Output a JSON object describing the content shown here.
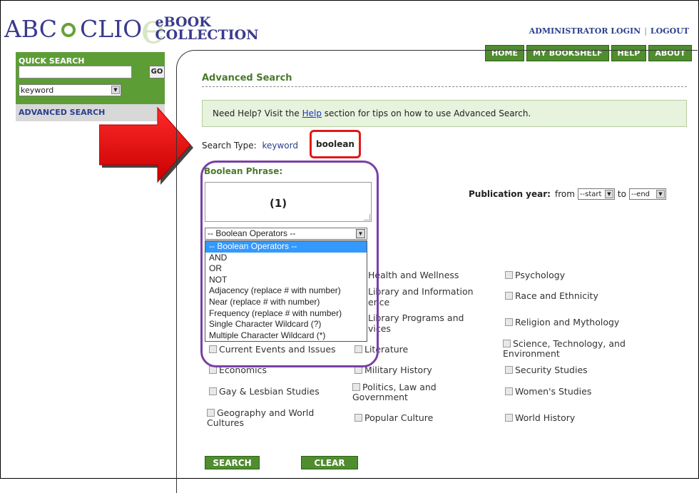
{
  "header": {
    "logo_left": "ABC",
    "logo_right": "CLIO",
    "logo_e": "e",
    "logo_ebook": "eBOOK",
    "logo_collection": "COLLECTION",
    "admin_login": "ADMINISTRATOR LOGIN",
    "separator": "|",
    "logout": "LOGOUT"
  },
  "nav": {
    "home": "HOME",
    "bookshelf": "MY BOOKSHELF",
    "help": "HELP",
    "about": "ABOUT"
  },
  "sidebar": {
    "quick_search_title": "QUICK SEARCH",
    "go_label": "GO",
    "search_type_value": "keyword",
    "advanced_search": "ADVANCED SEARCH"
  },
  "main": {
    "title": "Advanced Search",
    "help_prefix": "Need Help? Visit the ",
    "help_link": "Help",
    "help_suffix": " section for tips on how to use Advanced Search.",
    "search_type_label": "Search Type:",
    "keyword_option": "keyword",
    "boolean_option": "boolean",
    "boolean_phrase_label": "Boolean Phrase:",
    "annotation": "(1)",
    "pub_year_label": "Publication year:",
    "from_label": "from",
    "to_label": "to",
    "start_value": "--start",
    "end_value": "--end"
  },
  "operators": {
    "selected": "-- Boolean Operators --",
    "options": [
      "-- Boolean Operators --",
      "AND",
      "OR",
      "NOT",
      "Adjacency (replace # with number)",
      "Near (replace # with number)",
      "Frequency (replace # with number)",
      "Single Character Wildcard (?)",
      "Multiple Character Wildcard (*)"
    ]
  },
  "subjects": {
    "col1": [
      "Current Events and Issues",
      "Economics",
      "Gay & Lesbian Studies",
      "Geography and World Cultures"
    ],
    "col2_partial": [
      "Health and Wellness",
      "Library and Information",
      "ence",
      "Library Programs and",
      "vices",
      "Literature",
      "Military History",
      "Politics, Law and Government",
      "Popular Culture"
    ],
    "col3": [
      "Psychology",
      "Race and Ethnicity",
      "Religion and Mythology",
      "Science, Technology, and Environment",
      "Security Studies",
      "Women's Studies",
      "World History"
    ]
  },
  "buttons": {
    "search": "SEARCH",
    "clear": "CLEAR"
  }
}
